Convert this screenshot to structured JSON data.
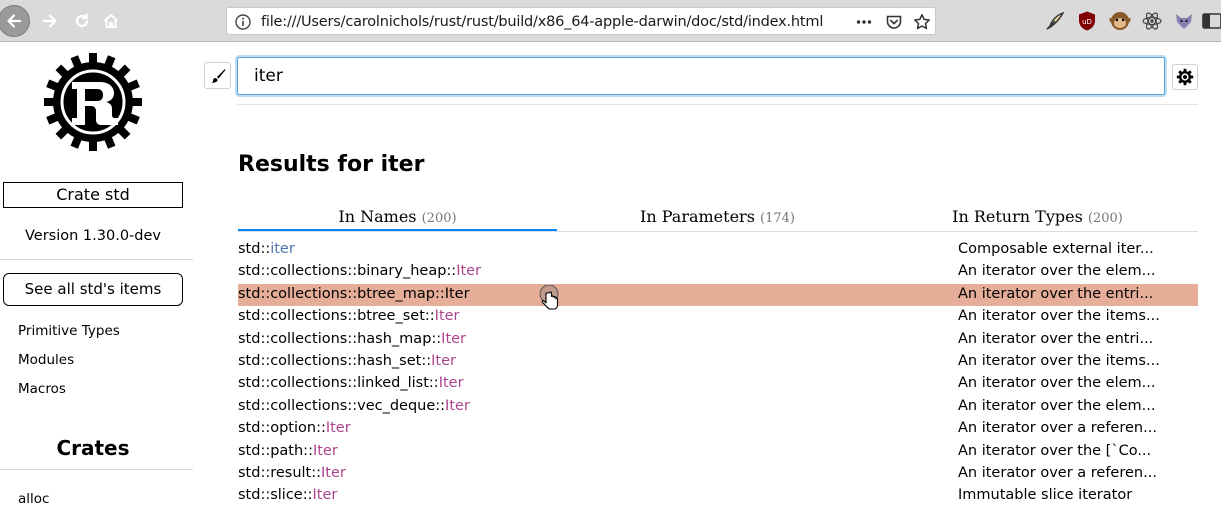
{
  "browser": {
    "url": "file:///Users/carolnichols/rust/rust/build/x86_64-apple-darwin/doc/std/index.html",
    "buttons": {
      "back": "back-icon",
      "forward": "forward-icon",
      "reload": "reload-icon",
      "home": "home-icon"
    },
    "url_actions": [
      "more-icon",
      "pocket-icon",
      "bookmark-star-icon"
    ],
    "extensions": [
      "feather-icon",
      "ublock-icon",
      "monkey-icon",
      "react-icon",
      "fox-icon",
      "sidebar-icon"
    ]
  },
  "sidebar": {
    "crate_label": "Crate std",
    "version": "Version 1.30.0-dev",
    "all_items_label": "See all std's items",
    "links": [
      "Primitive Types",
      "Modules",
      "Macros"
    ],
    "crates_title": "Crates",
    "crates": [
      "alloc"
    ]
  },
  "search": {
    "value": "iter",
    "brush_icon": "brush-icon",
    "settings_icon": "settings-icon"
  },
  "results": {
    "title": "Results for iter",
    "tabs": [
      {
        "label": "In Names",
        "count": "(200)",
        "active": true
      },
      {
        "label": "In Parameters",
        "count": "(174)",
        "active": false
      },
      {
        "label": "In Return Types",
        "count": "(200)",
        "active": false
      }
    ],
    "rows": [
      {
        "path": "std::",
        "name": "iter",
        "kind": "mod",
        "desc": "Composable external iter..."
      },
      {
        "path": "std::collections::binary_heap::",
        "name": "Iter",
        "kind": "struct",
        "desc": "An iterator over the elem..."
      },
      {
        "path": "std::collections::btree_map::",
        "name": "Iter",
        "kind": "struct",
        "desc": "An iterator over the entri...",
        "highlight": true
      },
      {
        "path": "std::collections::btree_set::",
        "name": "Iter",
        "kind": "struct",
        "desc": "An iterator over the items..."
      },
      {
        "path": "std::collections::hash_map::",
        "name": "Iter",
        "kind": "struct",
        "desc": "An iterator over the entri..."
      },
      {
        "path": "std::collections::hash_set::",
        "name": "Iter",
        "kind": "struct",
        "desc": "An iterator over the items..."
      },
      {
        "path": "std::collections::linked_list::",
        "name": "Iter",
        "kind": "struct",
        "desc": "An iterator over the elem..."
      },
      {
        "path": "std::collections::vec_deque::",
        "name": "Iter",
        "kind": "struct",
        "desc": "An iterator over the elem..."
      },
      {
        "path": "std::option::",
        "name": "Iter",
        "kind": "struct",
        "desc": "An iterator over a referen..."
      },
      {
        "path": "std::path::",
        "name": "Iter",
        "kind": "struct",
        "desc": "An iterator over the [`Co..."
      },
      {
        "path": "std::result::",
        "name": "Iter",
        "kind": "struct",
        "desc": "An iterator over a referen..."
      },
      {
        "path": "std::slice::",
        "name": "Iter",
        "kind": "struct",
        "desc": "Immutable slice iterator"
      }
    ]
  },
  "colors": {
    "highlight_row": "#e6ad99",
    "struct_name": "#ad448e",
    "module_name": "#4d76ae",
    "active_tab": "#0089ff"
  }
}
